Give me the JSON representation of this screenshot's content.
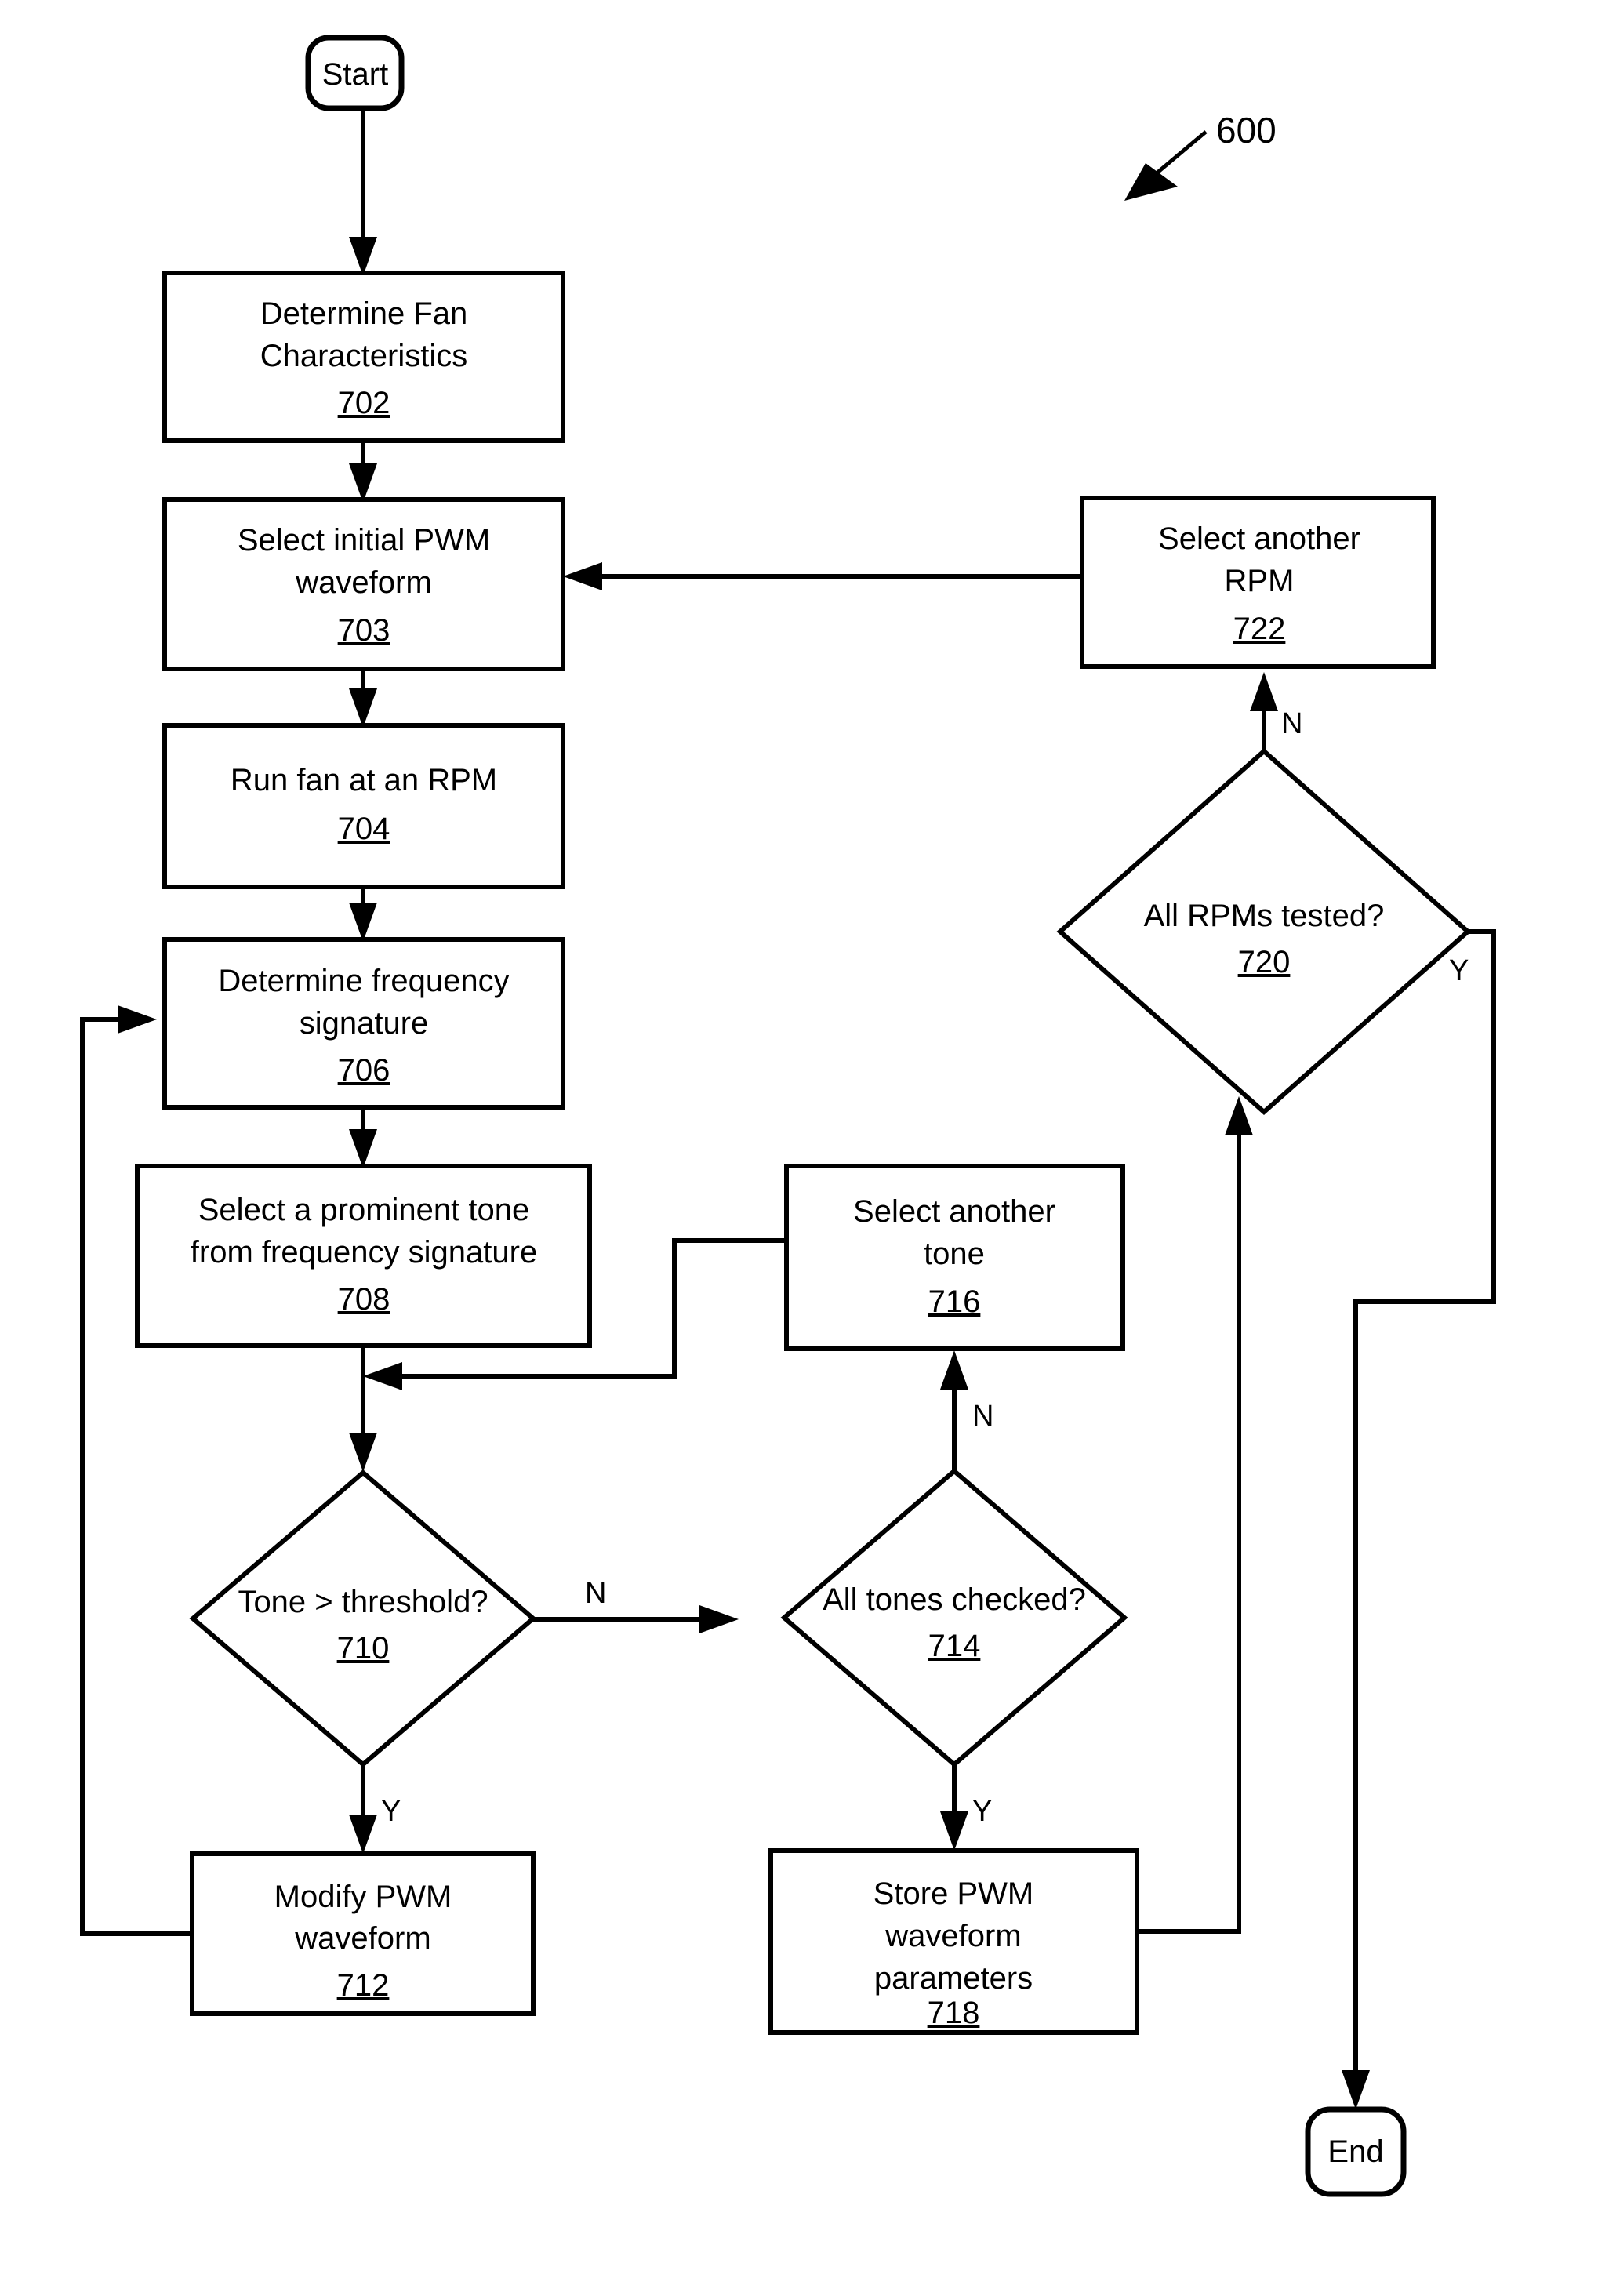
{
  "figure": {
    "number": "600",
    "type": "flowchart",
    "title_ref": "600"
  },
  "terminators": [
    {
      "id": "start",
      "label": "Start"
    },
    {
      "id": "end",
      "label": "End"
    }
  ],
  "nodes": [
    {
      "id": "n702",
      "shape": "process",
      "lines": [
        "Determine Fan",
        "Characteristics"
      ],
      "ref": "702"
    },
    {
      "id": "n703",
      "shape": "process",
      "lines": [
        "Select initial PWM",
        "waveform"
      ],
      "ref": "703"
    },
    {
      "id": "n704",
      "shape": "process",
      "lines": [
        "Run fan at an RPM"
      ],
      "ref": "704"
    },
    {
      "id": "n706",
      "shape": "process",
      "lines": [
        "Determine frequency",
        "signature"
      ],
      "ref": "706"
    },
    {
      "id": "n708",
      "shape": "process",
      "lines": [
        "Select a prominent tone",
        "from frequency signature"
      ],
      "ref": "708"
    },
    {
      "id": "n710",
      "shape": "decision",
      "lines": [
        "Tone > threshold?"
      ],
      "ref": "710"
    },
    {
      "id": "n712",
      "shape": "process",
      "lines": [
        "Modify PWM",
        "waveform"
      ],
      "ref": "712"
    },
    {
      "id": "n714",
      "shape": "decision",
      "lines": [
        "All tones checked?"
      ],
      "ref": "714"
    },
    {
      "id": "n716",
      "shape": "process",
      "lines": [
        "Select another",
        "tone"
      ],
      "ref": "716"
    },
    {
      "id": "n718",
      "shape": "process",
      "lines": [
        "Store PWM",
        "waveform",
        "parameters"
      ],
      "ref": "718"
    },
    {
      "id": "n720",
      "shape": "decision",
      "lines": [
        "All RPMs tested?"
      ],
      "ref": "720"
    },
    {
      "id": "n722",
      "shape": "process",
      "lines": [
        "Select another",
        "RPM"
      ],
      "ref": "722"
    }
  ],
  "branch_labels": [
    {
      "id": "b710n",
      "text": "N",
      "from": "n710",
      "to": "n714"
    },
    {
      "id": "b710y",
      "text": "Y",
      "from": "n710",
      "to": "n712"
    },
    {
      "id": "b714n",
      "text": "N",
      "from": "n714",
      "to": "n716"
    },
    {
      "id": "b714y",
      "text": "Y",
      "from": "n714",
      "to": "n718"
    },
    {
      "id": "b720n",
      "text": "N",
      "from": "n720",
      "to": "n722"
    },
    {
      "id": "b720y",
      "text": "Y",
      "from": "n720",
      "to": "end"
    }
  ],
  "edges": [
    {
      "from": "start",
      "to": "n702"
    },
    {
      "from": "n702",
      "to": "n703"
    },
    {
      "from": "n703",
      "to": "n704"
    },
    {
      "from": "n704",
      "to": "n706"
    },
    {
      "from": "n706",
      "to": "n708"
    },
    {
      "from": "n708",
      "to": "n710"
    },
    {
      "from": "n710",
      "to": "n712",
      "label": "Y"
    },
    {
      "from": "n710",
      "to": "n714",
      "label": "N"
    },
    {
      "from": "n712",
      "to": "n706"
    },
    {
      "from": "n714",
      "to": "n716",
      "label": "N"
    },
    {
      "from": "n714",
      "to": "n718",
      "label": "Y"
    },
    {
      "from": "n716",
      "to": "n710"
    },
    {
      "from": "n718",
      "to": "n720"
    },
    {
      "from": "n720",
      "to": "n722",
      "label": "N"
    },
    {
      "from": "n720",
      "to": "end",
      "label": "Y"
    },
    {
      "from": "n722",
      "to": "n703"
    }
  ]
}
